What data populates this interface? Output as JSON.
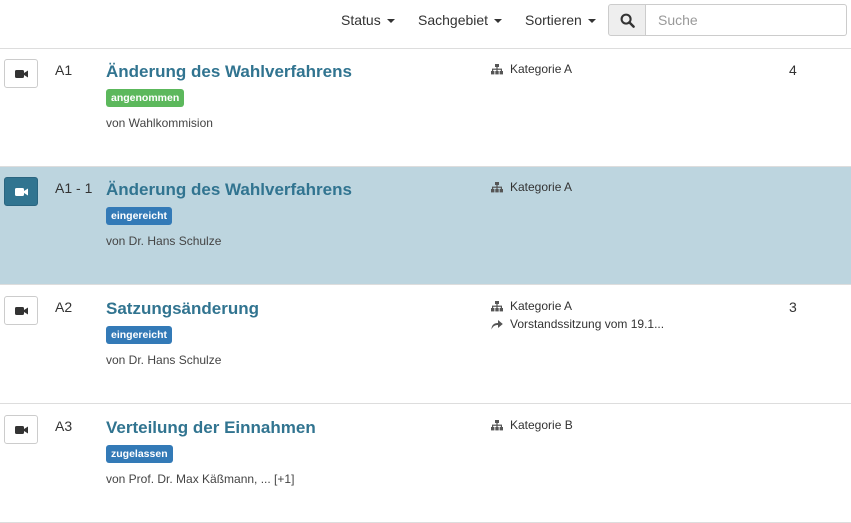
{
  "toolbar": {
    "status_label": "Status",
    "topic_label": "Sachgebiet",
    "sort_label": "Sortieren",
    "search_placeholder": "Suche"
  },
  "motions": [
    {
      "identifier": "A1",
      "title": "Änderung des Wahlverfahrens",
      "state": "angenommen",
      "state_color": "#5cb85c",
      "submitter": "von Wahlkommision",
      "category": "Kategorie A",
      "recommendation": "",
      "count": "4"
    },
    {
      "identifier": "A1 - 1",
      "title": "Änderung des Wahlverfahrens",
      "state": "eingereicht",
      "state_color": "#337ab7",
      "submitter": "von Dr. Hans Schulze",
      "category": "Kategorie A",
      "recommendation": "",
      "count": ""
    },
    {
      "identifier": "A2",
      "title": "Satzungsänderung",
      "state": "eingereicht",
      "state_color": "#337ab7",
      "submitter": "von Dr. Hans Schulze",
      "category": "Kategorie A",
      "recommendation": "Vorstandssitzung vom 19.1...",
      "count": "3"
    },
    {
      "identifier": "A3",
      "title": "Verteilung der Einnahmen",
      "state": "zugelassen",
      "state_color": "#337ab7",
      "submitter": "von Prof. Dr. Max Käßmann, ... [+1]",
      "category": "Kategorie B",
      "recommendation": "",
      "count": ""
    }
  ],
  "colors": {
    "accent": "#317490",
    "active_row": "#bdd5df"
  }
}
